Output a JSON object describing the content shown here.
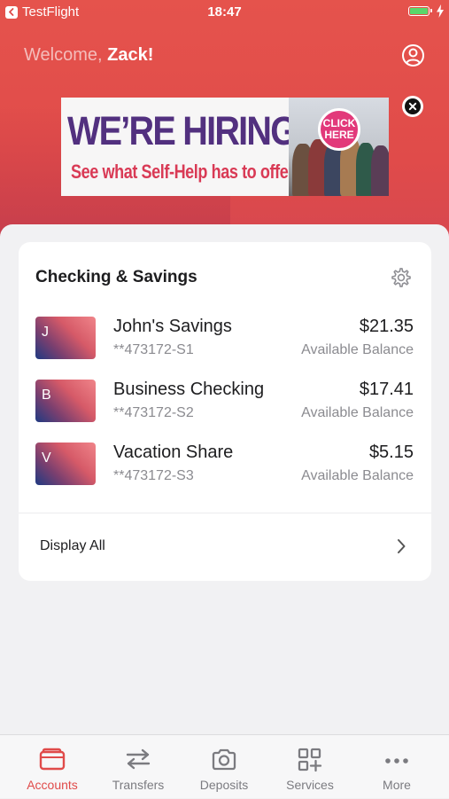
{
  "status_bar": {
    "back_app": "TestFlight",
    "time": "18:47"
  },
  "header": {
    "welcome_prefix": "Welcome,",
    "user_name": "Zack!"
  },
  "banner": {
    "headline": "WE’RE HIRING!",
    "subline": "See what Self-Help has to offer",
    "cta": "CLICK\nHERE"
  },
  "accounts_card": {
    "title": "Checking & Savings",
    "accounts": [
      {
        "initial": "J",
        "name": "John's Savings",
        "number": "**473172-S1",
        "amount": "$21.35",
        "balance_label": "Available Balance"
      },
      {
        "initial": "B",
        "name": "Business Checking",
        "number": "**473172-S2",
        "amount": "$17.41",
        "balance_label": "Available Balance"
      },
      {
        "initial": "V",
        "name": "Vacation Share",
        "number": "**473172-S3",
        "amount": "$5.15",
        "balance_label": "Available Balance"
      }
    ],
    "display_all_label": "Display All"
  },
  "tab_bar": {
    "tabs": [
      {
        "label": "Accounts",
        "icon": "wallet-icon",
        "active": true
      },
      {
        "label": "Transfers",
        "icon": "transfer-arrows-icon",
        "active": false
      },
      {
        "label": "Deposits",
        "icon": "camera-icon",
        "active": false
      },
      {
        "label": "Services",
        "icon": "grid-plus-icon",
        "active": false
      },
      {
        "label": "More",
        "icon": "more-dots-icon",
        "active": false
      }
    ]
  },
  "colors": {
    "brand_red": "#e04b4a",
    "inactive_tab": "#7b7b80",
    "battery_green": "#59d66a"
  }
}
